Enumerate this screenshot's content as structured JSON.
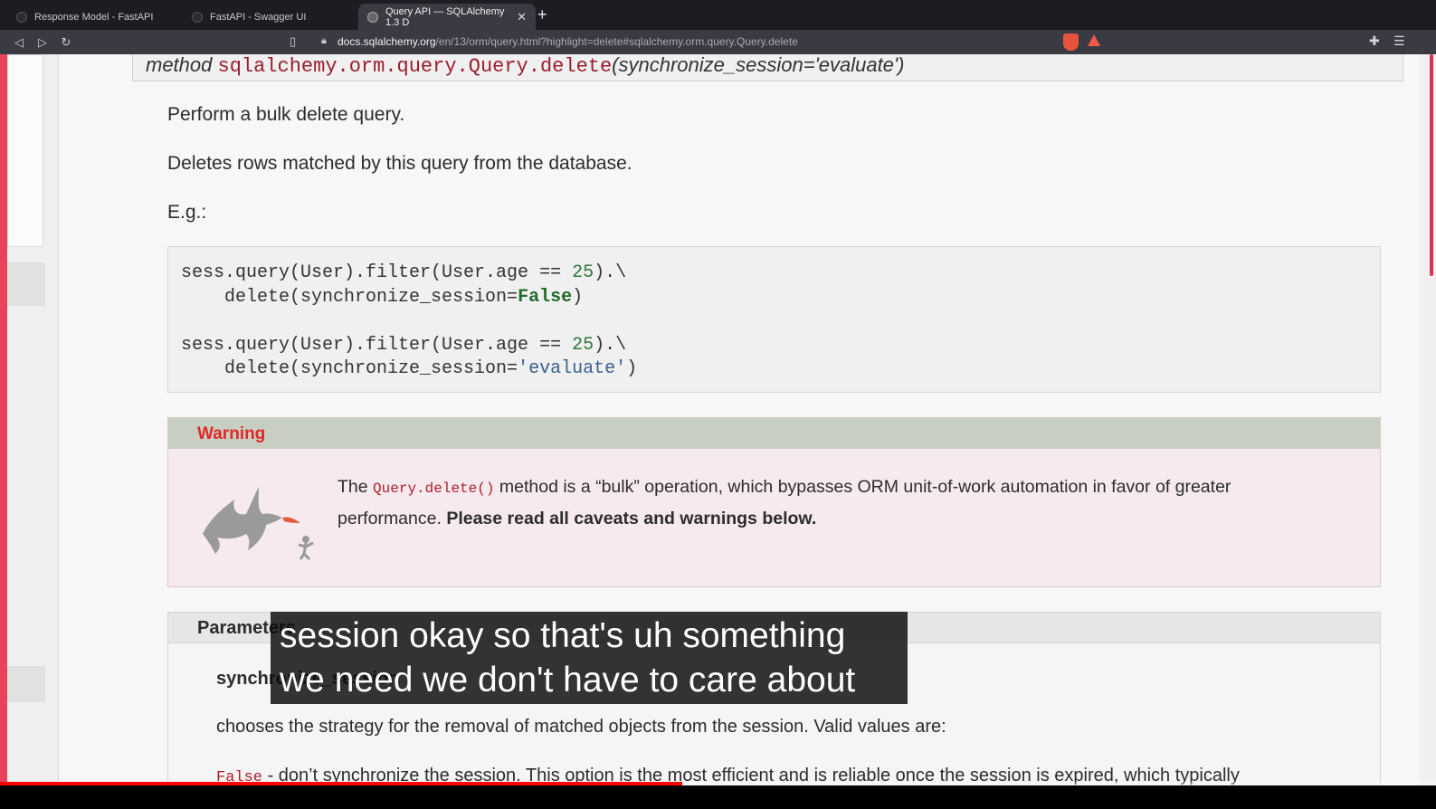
{
  "browser": {
    "tabs": [
      {
        "title": "Response Model - FastAPI",
        "active": false
      },
      {
        "title": "FastAPI - Swagger UI",
        "active": false
      },
      {
        "title": "Query API — SQLAlchemy 1.3 D",
        "active": true
      }
    ],
    "new_tab_label": "+",
    "tab_close_label": "✕",
    "url_host": "docs.sqlalchemy.org",
    "url_path": "/en/13/orm/query.html?highlight=delete#sqlalchemy.orm.query.Query.delete"
  },
  "signature": {
    "prefix": "method ",
    "code": "sqlalchemy.orm.query.Query.delete",
    "args": "(synchronize_session='evaluate')"
  },
  "content": {
    "para1": "Perform a bulk delete query.",
    "para2": "Deletes rows matched by this query from the database.",
    "para3": "E.g.:"
  },
  "code": {
    "l1_a": "sess.query(User).filter(User.age == ",
    "l1_num": "25",
    "l1_b": ").\\",
    "l2_a": "    delete(synchronize_session=",
    "l2_kw": "False",
    "l2_b": ")",
    "l3_a": "sess.query(User).filter(User.age == ",
    "l3_num": "25",
    "l3_b": ").\\",
    "l4_a": "    delete(synchronize_session=",
    "l4_str": "'evaluate'",
    "l4_b": ")"
  },
  "warning": {
    "title": "Warning",
    "text_a": "The ",
    "text_code": "Query.delete()",
    "text_b": " method is a “bulk” operation, which bypasses ORM unit-of-work automation in favor of greater performance. ",
    "text_bold": "Please read all caveats and warnings below."
  },
  "parameters": {
    "title": "Parameters",
    "name": "synchronize_session",
    "description": "chooses the strategy for the removal of matched objects from the session. Valid values are:",
    "false_code": "False",
    "false_text": " - don’t synchronize the session. This option is the most efficient and is reliable once the session is expired, which typically"
  },
  "caption": {
    "line1": "session okay so that's uh something",
    "line2": "we need we don't have to care about"
  },
  "video": {
    "progress": 0.475
  },
  "colors": {
    "accent_red": "#e02828",
    "code_red": "#9b1c2a"
  }
}
